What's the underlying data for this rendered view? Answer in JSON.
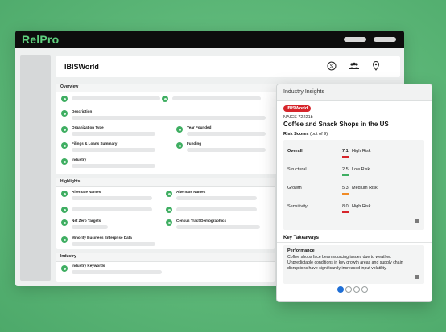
{
  "app": {
    "logo": "RelPro"
  },
  "header": {
    "title": "IBISWorld",
    "icons": [
      "dollar-icon",
      "people-icon",
      "location-pin-icon"
    ]
  },
  "overview": {
    "title": "Overview",
    "description_label": "Description",
    "org_type_label": "Organization Type",
    "year_founded_label": "Year Founded",
    "filings_label": "Filings & Loans Summary",
    "funding_label": "Funding",
    "industry_label": "Industry"
  },
  "highlights": {
    "title": "Highlights",
    "alt_names_left": "Alternate Names",
    "alt_names_right": "Alternate Names",
    "net_zero_label": "Net Zero Targets",
    "census_label": "Census Tract Demographics",
    "minority_label": "Minority Business Enterprise Data"
  },
  "industry_section": {
    "title": "Industry",
    "keywords_label": "Industry Keywords"
  },
  "insights": {
    "panel_title": "Industry Insights",
    "source_badge": "IBISWorld",
    "naics": "NAICS 72221b",
    "industry_name": "Coffee and Snack Shops in the US",
    "risk_title": "Risk Scores",
    "risk_suffix": "(out of 9)",
    "risk_scores": [
      {
        "name": "Overall",
        "score": "7.1",
        "level": "High Risk",
        "color": "#d6252b"
      },
      {
        "name": "Structural",
        "score": "2.5",
        "level": "Low Risk",
        "color": "#3fae62"
      },
      {
        "name": "Growth",
        "score": "5.3",
        "level": "Medium Risk",
        "color": "#f08a24"
      },
      {
        "name": "Sensitivity",
        "score": "8.0",
        "level": "High Risk",
        "color": "#d6252b"
      }
    ],
    "takeaways_title": "Key Takeaways",
    "takeaway": {
      "heading": "Performance",
      "text": "Coffee shops face bean-sourcing issues due to weather. Unpredictable conditions in key growth areas and supply chain disruptions have significantly increased input volatility."
    },
    "pagination": {
      "total": 4,
      "active": 1
    }
  }
}
